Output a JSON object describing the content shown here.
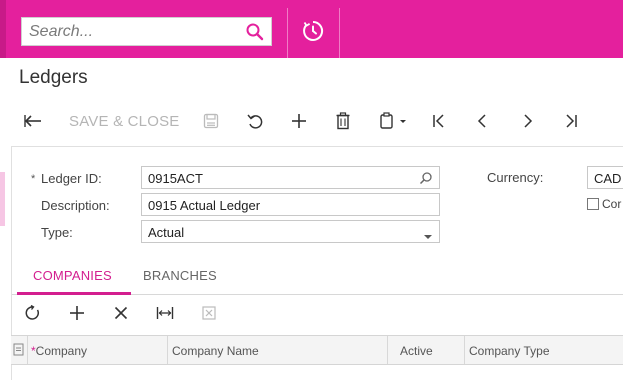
{
  "search": {
    "placeholder": "Search..."
  },
  "page": {
    "title": "Ledgers"
  },
  "toolbar": {
    "save_close_label": "SAVE & CLOSE",
    "icons": [
      "back-arrow-icon",
      "save-icon",
      "undo-icon",
      "add-icon",
      "delete-icon",
      "clipboard-icon",
      "first-icon",
      "previous-icon",
      "next-icon",
      "last-icon"
    ]
  },
  "form": {
    "ledger_id": {
      "label": "Ledger ID:",
      "value": "0915ACT",
      "required_mark": "*"
    },
    "description": {
      "label": "Description:",
      "value": "0915 Actual Ledger"
    },
    "type": {
      "label": "Type:",
      "value": "Actual"
    },
    "currency": {
      "label": "Currency:",
      "value": "CAD"
    },
    "checkbox_label": "Cor"
  },
  "tabs": [
    {
      "label": "COMPANIES",
      "active": true
    },
    {
      "label": "BRANCHES",
      "active": false
    }
  ],
  "grid": {
    "columns": [
      "Company",
      "Company Name",
      "Active",
      "Company Type"
    ],
    "required_mark": "*"
  },
  "colors": {
    "brand": "#e4209d",
    "accent": "#d31e8f",
    "disabled_text": "#b5b5b5"
  }
}
